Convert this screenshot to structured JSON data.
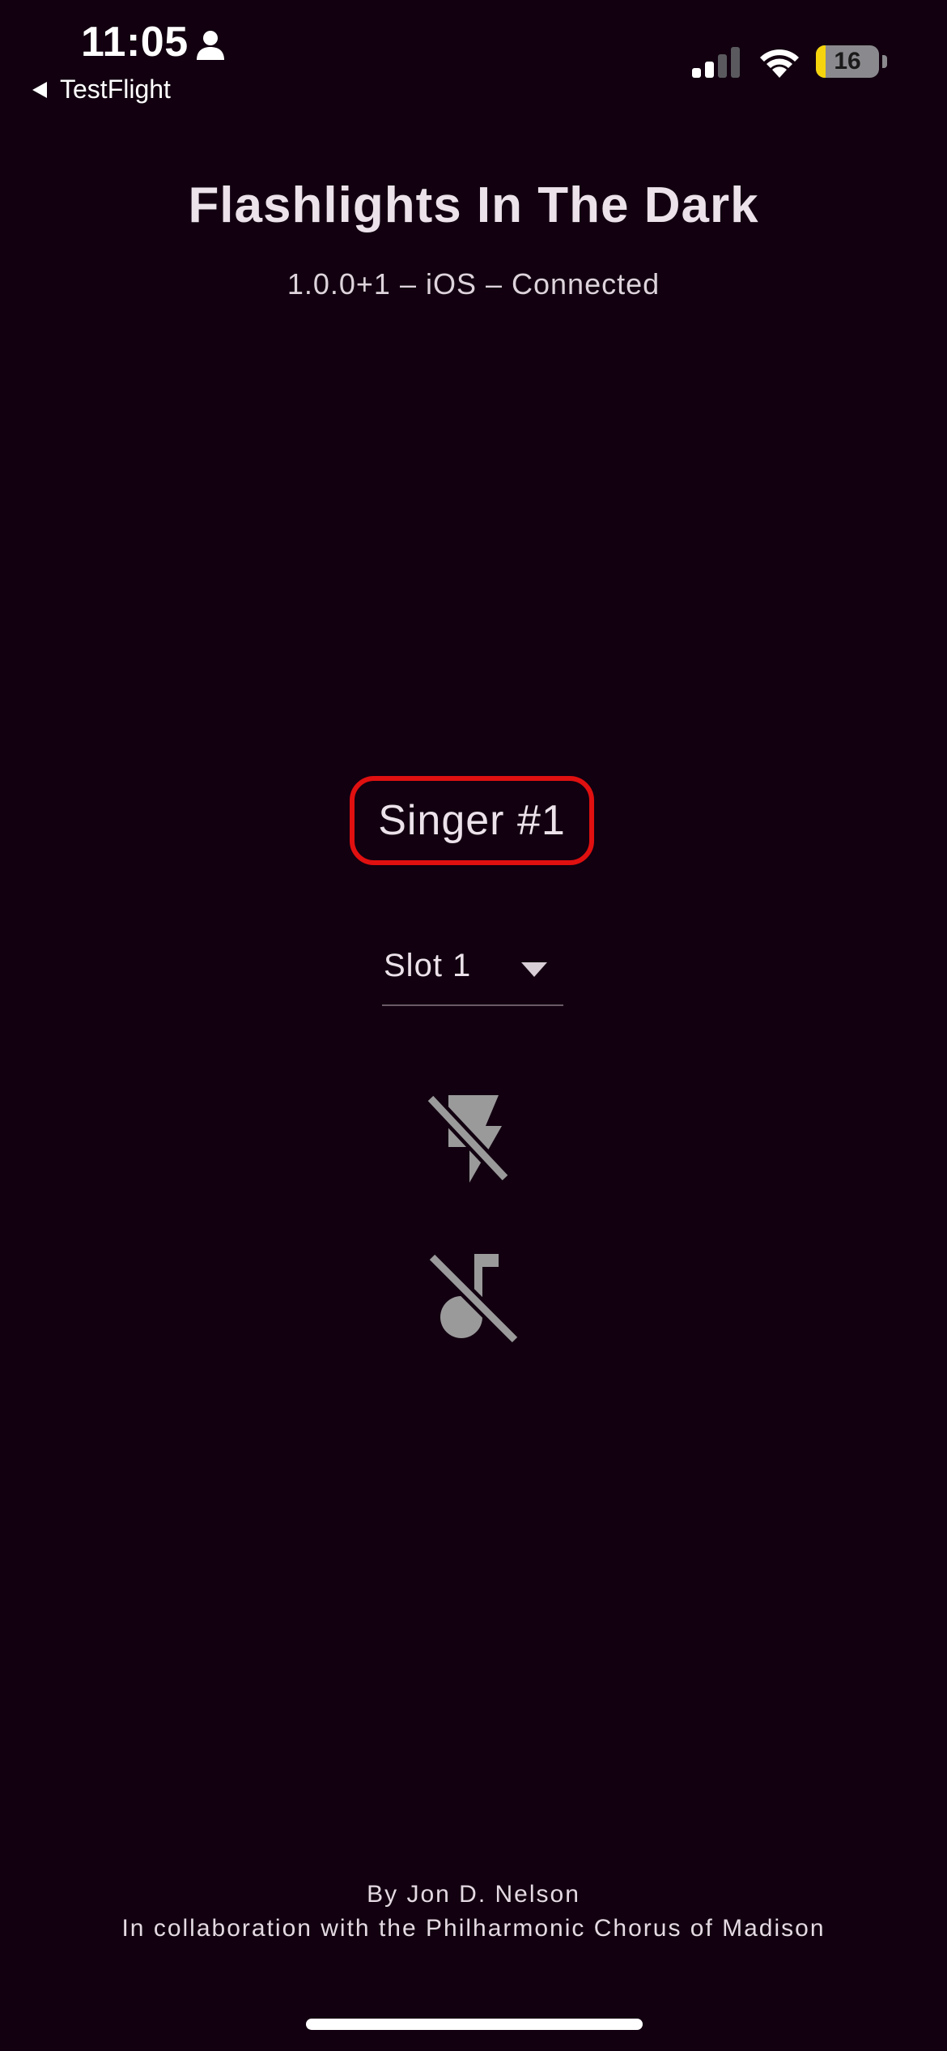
{
  "status_bar": {
    "time": "11:05",
    "back_app": "TestFlight",
    "battery_level": 16,
    "battery_text": "16",
    "signal_bars_active": 2,
    "signal_bars_total": 4
  },
  "header": {
    "title": "Flashlights In The Dark",
    "subtitle": "1.0.0+1 – iOS – Connected"
  },
  "main": {
    "singer_label": "Singer #1",
    "slot_dropdown": {
      "selected": "Slot 1"
    },
    "icons": {
      "flash": "flash-off-icon",
      "music": "music-off-icon"
    }
  },
  "footer": {
    "author": "By Jon D. Nelson",
    "collaboration": "In collaboration with the Philharmonic Chorus of Madison"
  },
  "colors": {
    "background": "#120010",
    "highlight_border": "#e01010",
    "icon_gray": "#9a9a9a",
    "battery_fill": "#f5d40d"
  }
}
